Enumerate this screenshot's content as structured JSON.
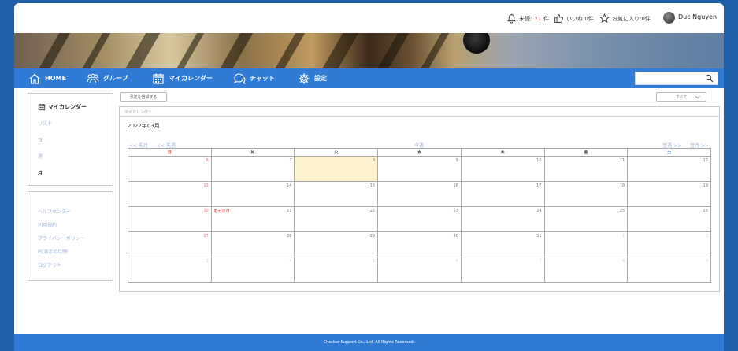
{
  "topbar": {
    "unread_label": "未読:",
    "unread_count": "71",
    "unread_suffix": "件",
    "likes": "いいね:0件",
    "favorites": "お気に入り:0件",
    "username": "Duc Nguyen"
  },
  "nav": {
    "home": "HOME",
    "group": "グループ",
    "my_calendar": "マイカレンダー",
    "chat": "チャット",
    "settings": "設定",
    "search_placeholder": ""
  },
  "sidebar": {
    "title": "マイカレンダー",
    "items": [
      "リスト",
      "日",
      "週",
      "月"
    ],
    "active_index": 3,
    "links": [
      "ヘルプセンター",
      "利用規約",
      "プライバシーポリシー",
      "PC表示の切替",
      "ログアウト"
    ]
  },
  "main": {
    "add_button": "予定を登録する",
    "select_label": "すべて",
    "box_header": "マイカレンダー",
    "month_label": "2022年03月",
    "prev_month": "<< 先月",
    "prev_week": "<< 先週",
    "today": "今週",
    "next_week": "翌週 >>",
    "next_month": "翌月 >>",
    "weekdays": [
      "日",
      "月",
      "火",
      "水",
      "木",
      "金",
      "土"
    ],
    "weeks": [
      [
        "6",
        "7",
        "8",
        "9",
        "10",
        "11",
        "12"
      ],
      [
        "13",
        "14",
        "15",
        "16",
        "17",
        "18",
        "19"
      ],
      [
        "20",
        "21",
        "22",
        "23",
        "24",
        "25",
        "26"
      ],
      [
        "27",
        "28",
        "29",
        "30",
        "31",
        "1",
        "2"
      ],
      [
        "3",
        "4",
        "5",
        "6",
        "7",
        "8",
        "9"
      ]
    ],
    "event": {
      "week": 2,
      "day": 1,
      "label": "春分の日"
    }
  },
  "footer": {
    "copyright": "Checker Support Co., Ltd. All Rights Reserved."
  },
  "colors": {
    "nav_blue": "#2f7bd6",
    "today_highlight": "#fdf3cf",
    "link": "#9fb4d6",
    "holiday": "#e04040"
  }
}
